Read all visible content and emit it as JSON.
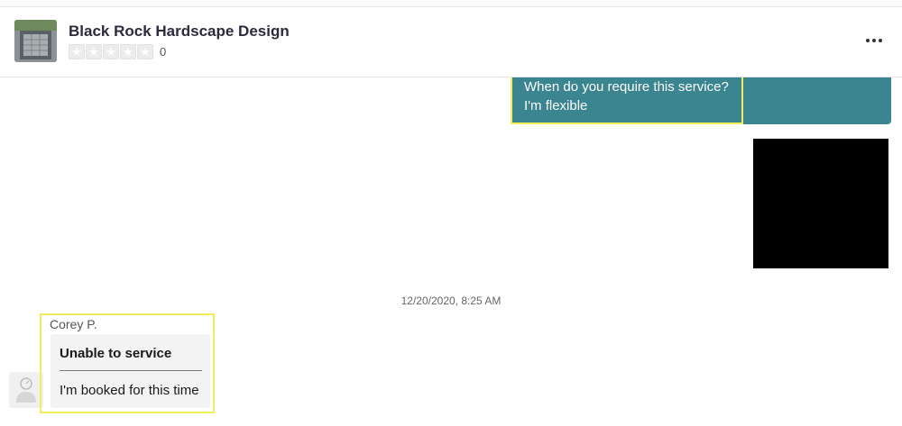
{
  "header": {
    "business_name": "Black Rock Hardscape Design",
    "rating_count": "0",
    "rating_stars": 0,
    "rating_max": 5,
    "thumbnail_icon": "business-photo",
    "more_icon": "more-horizontal-icon"
  },
  "messages": [
    {
      "side": "outgoing",
      "question": "When do you require this service?",
      "answer": "I'm flexible",
      "color": "#3b8590"
    },
    {
      "side": "outgoing",
      "type": "image"
    }
  ],
  "timestamp": "12/20/2020, 8:25 AM",
  "incoming": {
    "sender": "Corey P.",
    "card_title": "Unable to service",
    "card_body": "I'm booked for this time",
    "avatar_icon": "user-avatar-icon"
  },
  "colors": {
    "accent_teal": "#3b8590",
    "highlight_yellow": "#f2ee5a"
  }
}
